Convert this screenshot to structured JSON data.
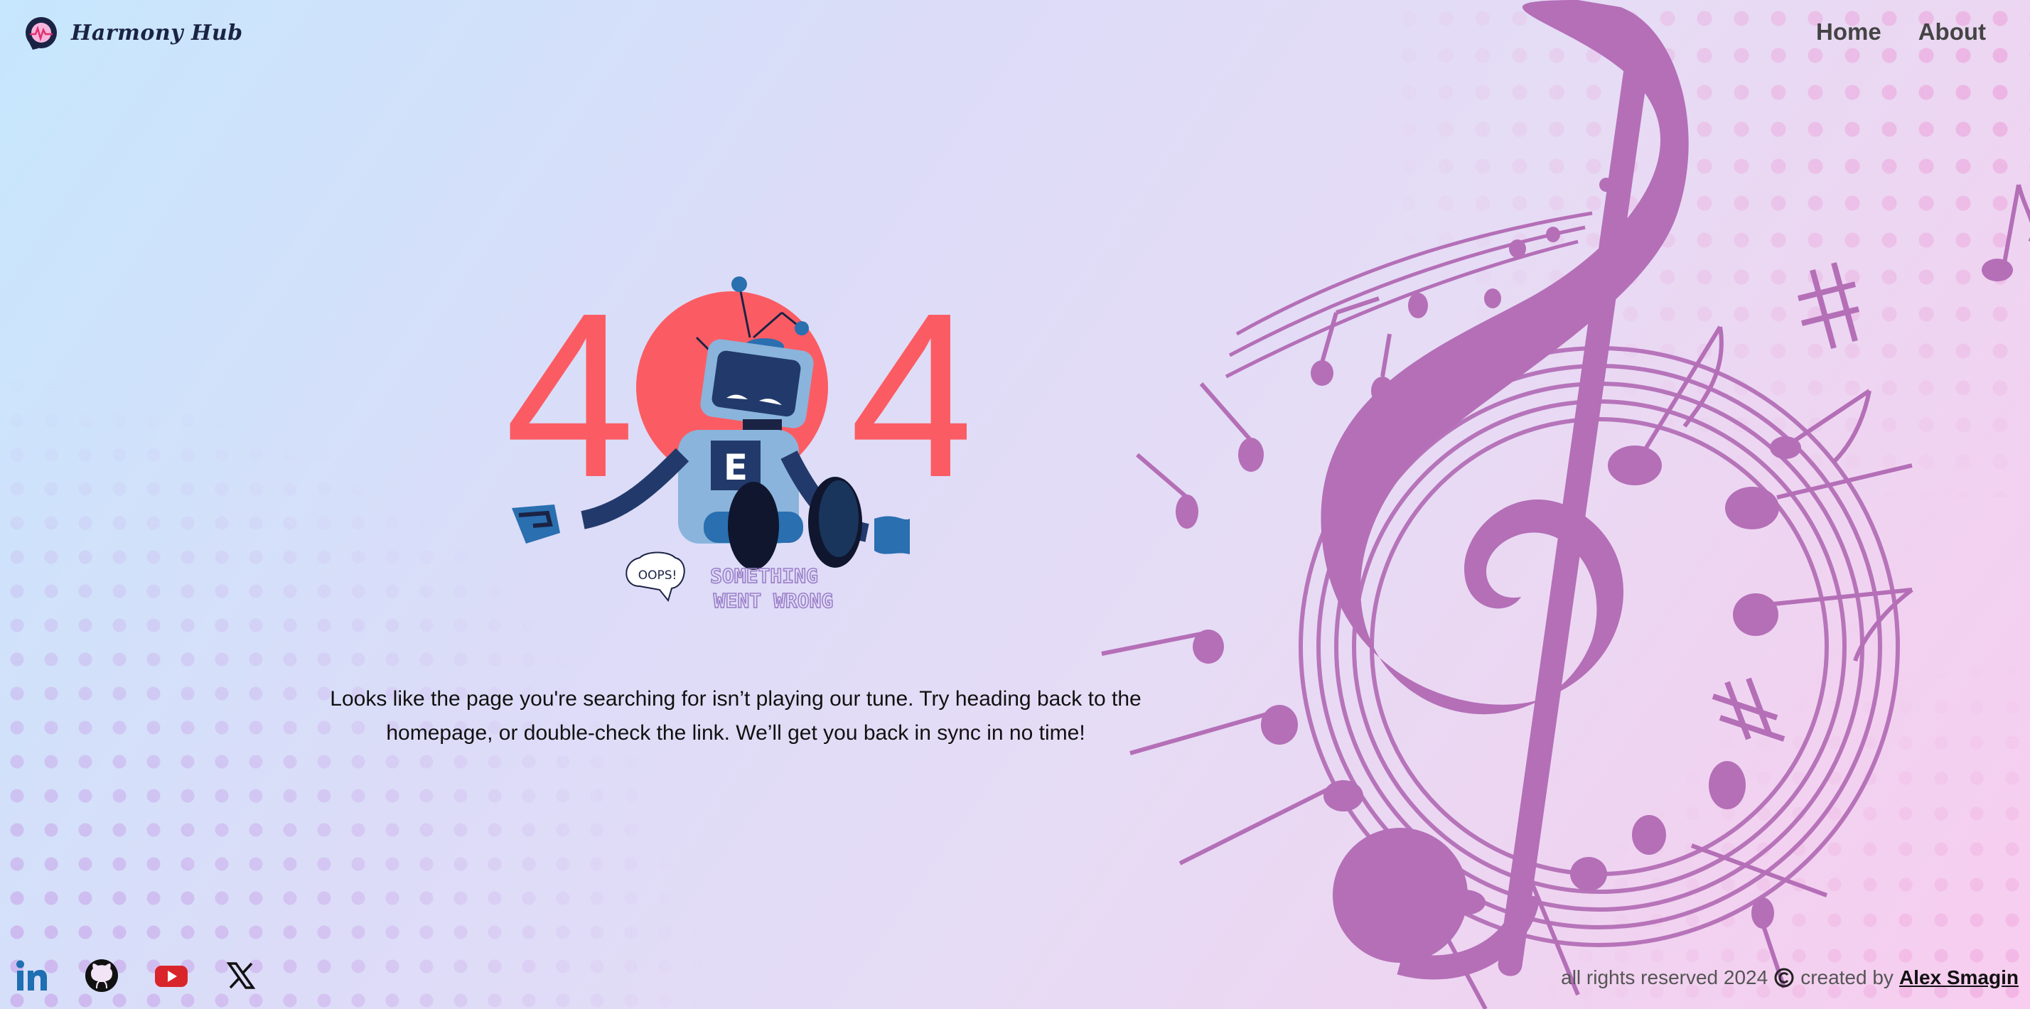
{
  "brand": {
    "name": "Harmony Hub",
    "logo_icon": "headphones-pulse-icon"
  },
  "nav": [
    {
      "label": "Home"
    },
    {
      "label": "About"
    }
  ],
  "error": {
    "code_left": "4",
    "code_right": "4",
    "robot_badge": "E",
    "bubble": "OOPS!",
    "tagline_line1": "SOMETHING",
    "tagline_line2": "WENT WRONG",
    "message": "Looks like the page you're searching for isn’t playing our tune. Try heading back to the homepage, or double-check the link. We’ll get you back in sync in no time!"
  },
  "socials": [
    {
      "name": "linkedin-icon"
    },
    {
      "name": "github-icon"
    },
    {
      "name": "youtube-icon"
    },
    {
      "name": "x-icon"
    }
  ],
  "footer": {
    "rights": "all rights reserved 2024",
    "created_by": "created by",
    "author": "Alex Smagin"
  },
  "colors": {
    "accent_red": "#fb5c63",
    "robot_dark": "#223a6b",
    "robot_light": "#8ab4dc",
    "music_purple": "#b46fb7",
    "tagline": "#9b7fc9"
  }
}
